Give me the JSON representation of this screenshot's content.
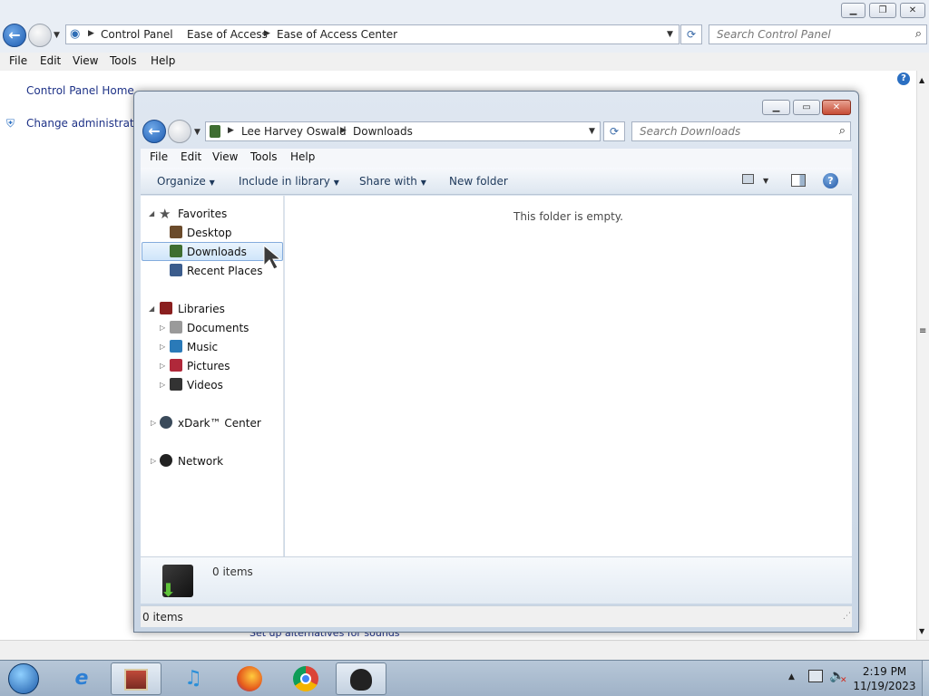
{
  "bg_window": {
    "breadcrumb": [
      "Control Panel",
      "Ease of Access",
      "Ease of Access Center"
    ],
    "search_placeholder": "Search Control Panel",
    "menu": [
      "File",
      "Edit",
      "View",
      "Tools",
      "Help"
    ],
    "sidebar": {
      "home_link": "Control Panel Home",
      "change_admin": "Change administrative"
    },
    "partial_text": "Set up alternatives for sounds"
  },
  "explorer": {
    "breadcrumb": [
      "Lee Harvey Oswald",
      "Downloads"
    ],
    "search_placeholder": "Search Downloads",
    "menu": [
      "File",
      "Edit",
      "View",
      "Tools",
      "Help"
    ],
    "toolbar": {
      "organize": "Organize",
      "include_in_library": "Include in library",
      "share_with": "Share with",
      "new_folder": "New folder"
    },
    "nav": {
      "favorites": "Favorites",
      "desktop": "Desktop",
      "downloads": "Downloads",
      "recent_places": "Recent Places",
      "libraries": "Libraries",
      "documents": "Documents",
      "music": "Music",
      "pictures": "Pictures",
      "videos": "Videos",
      "xdark_center": "xDark™ Center",
      "network": "Network"
    },
    "empty_message": "This folder is empty.",
    "details_count": "0 items",
    "status_count": "0 items"
  },
  "taskbar": {
    "time": "2:19 PM",
    "date": "11/19/2023"
  },
  "icons": {
    "start": "windows-start-orb",
    "ie": "internet-explorer",
    "library": "library-app",
    "music": "itunes",
    "firefox": "firefox",
    "chrome": "chrome",
    "active_app": "xdark-app"
  }
}
